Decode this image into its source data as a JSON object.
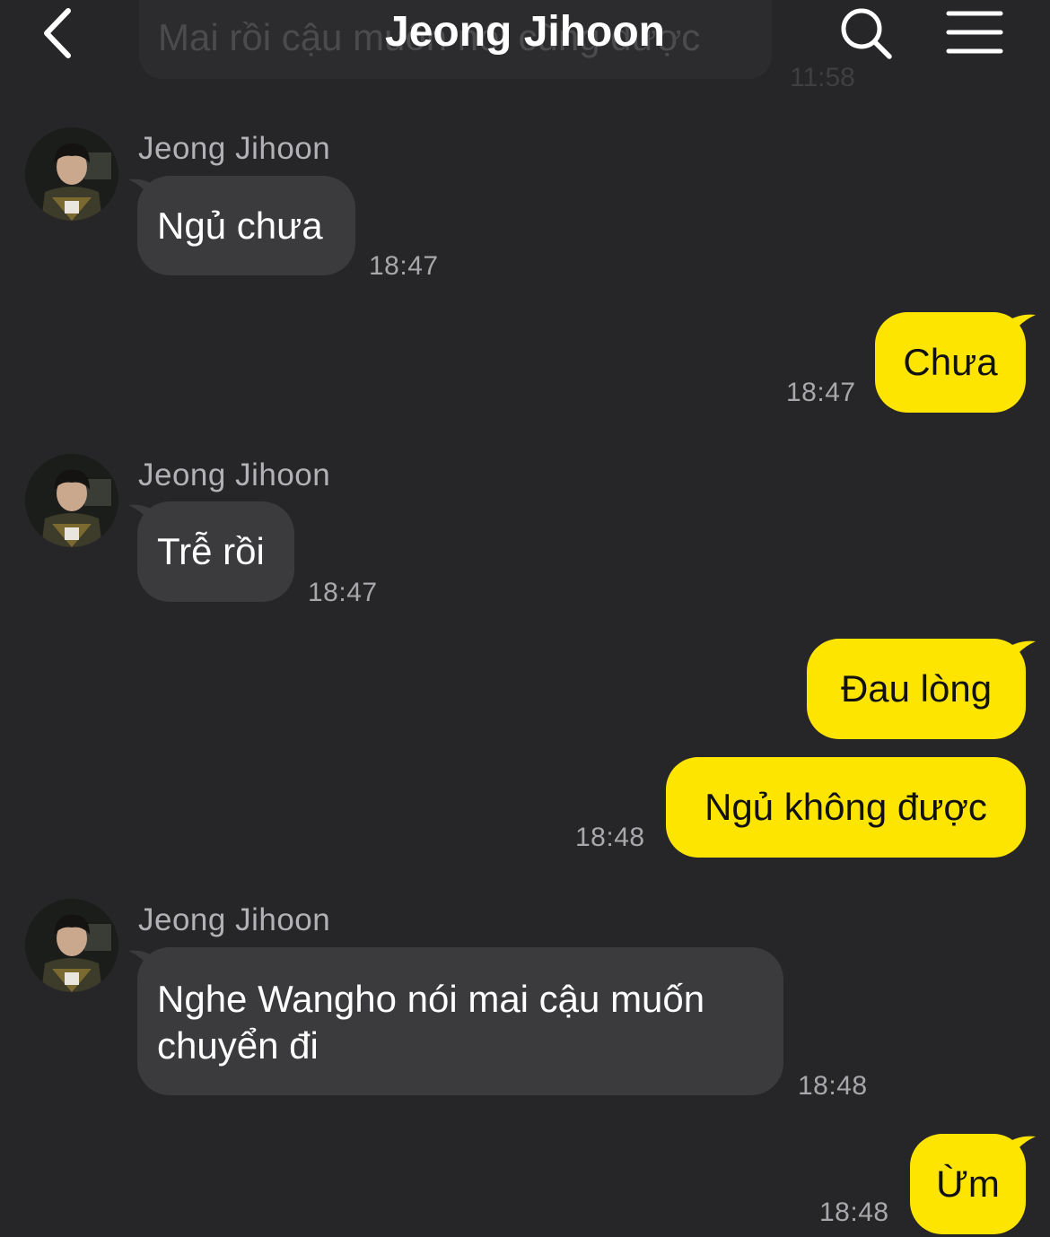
{
  "header": {
    "title": "Jeong Jihoon",
    "background_message_text": "Mai rồi cậu muốn nói cũng được",
    "background_message_time": "11:58"
  },
  "colors": {
    "background": "#262628",
    "incoming_bubble": "#3b3b3e",
    "outgoing_bubble": "#fee500",
    "timestamp": "#a8a8ac"
  },
  "icons": {
    "back": "chevron-left-icon",
    "search": "search-icon",
    "menu": "hamburger-menu-icon"
  },
  "messages": [
    {
      "sender": "Jeong Jihoon",
      "text": "Ngủ chưa",
      "time": "18:47"
    },
    {
      "text": "Chưa",
      "time": "18:47"
    },
    {
      "sender": "Jeong Jihoon",
      "text": "Trễ rồi",
      "time": "18:47"
    },
    {
      "text": "Đau lòng"
    },
    {
      "text": "Ngủ không được",
      "time": "18:48"
    },
    {
      "sender": "Jeong Jihoon",
      "text": "Nghe Wangho nói mai cậu muốn chuyển đi",
      "time": "18:48"
    },
    {
      "text": "Ừm",
      "time": "18:48"
    }
  ]
}
